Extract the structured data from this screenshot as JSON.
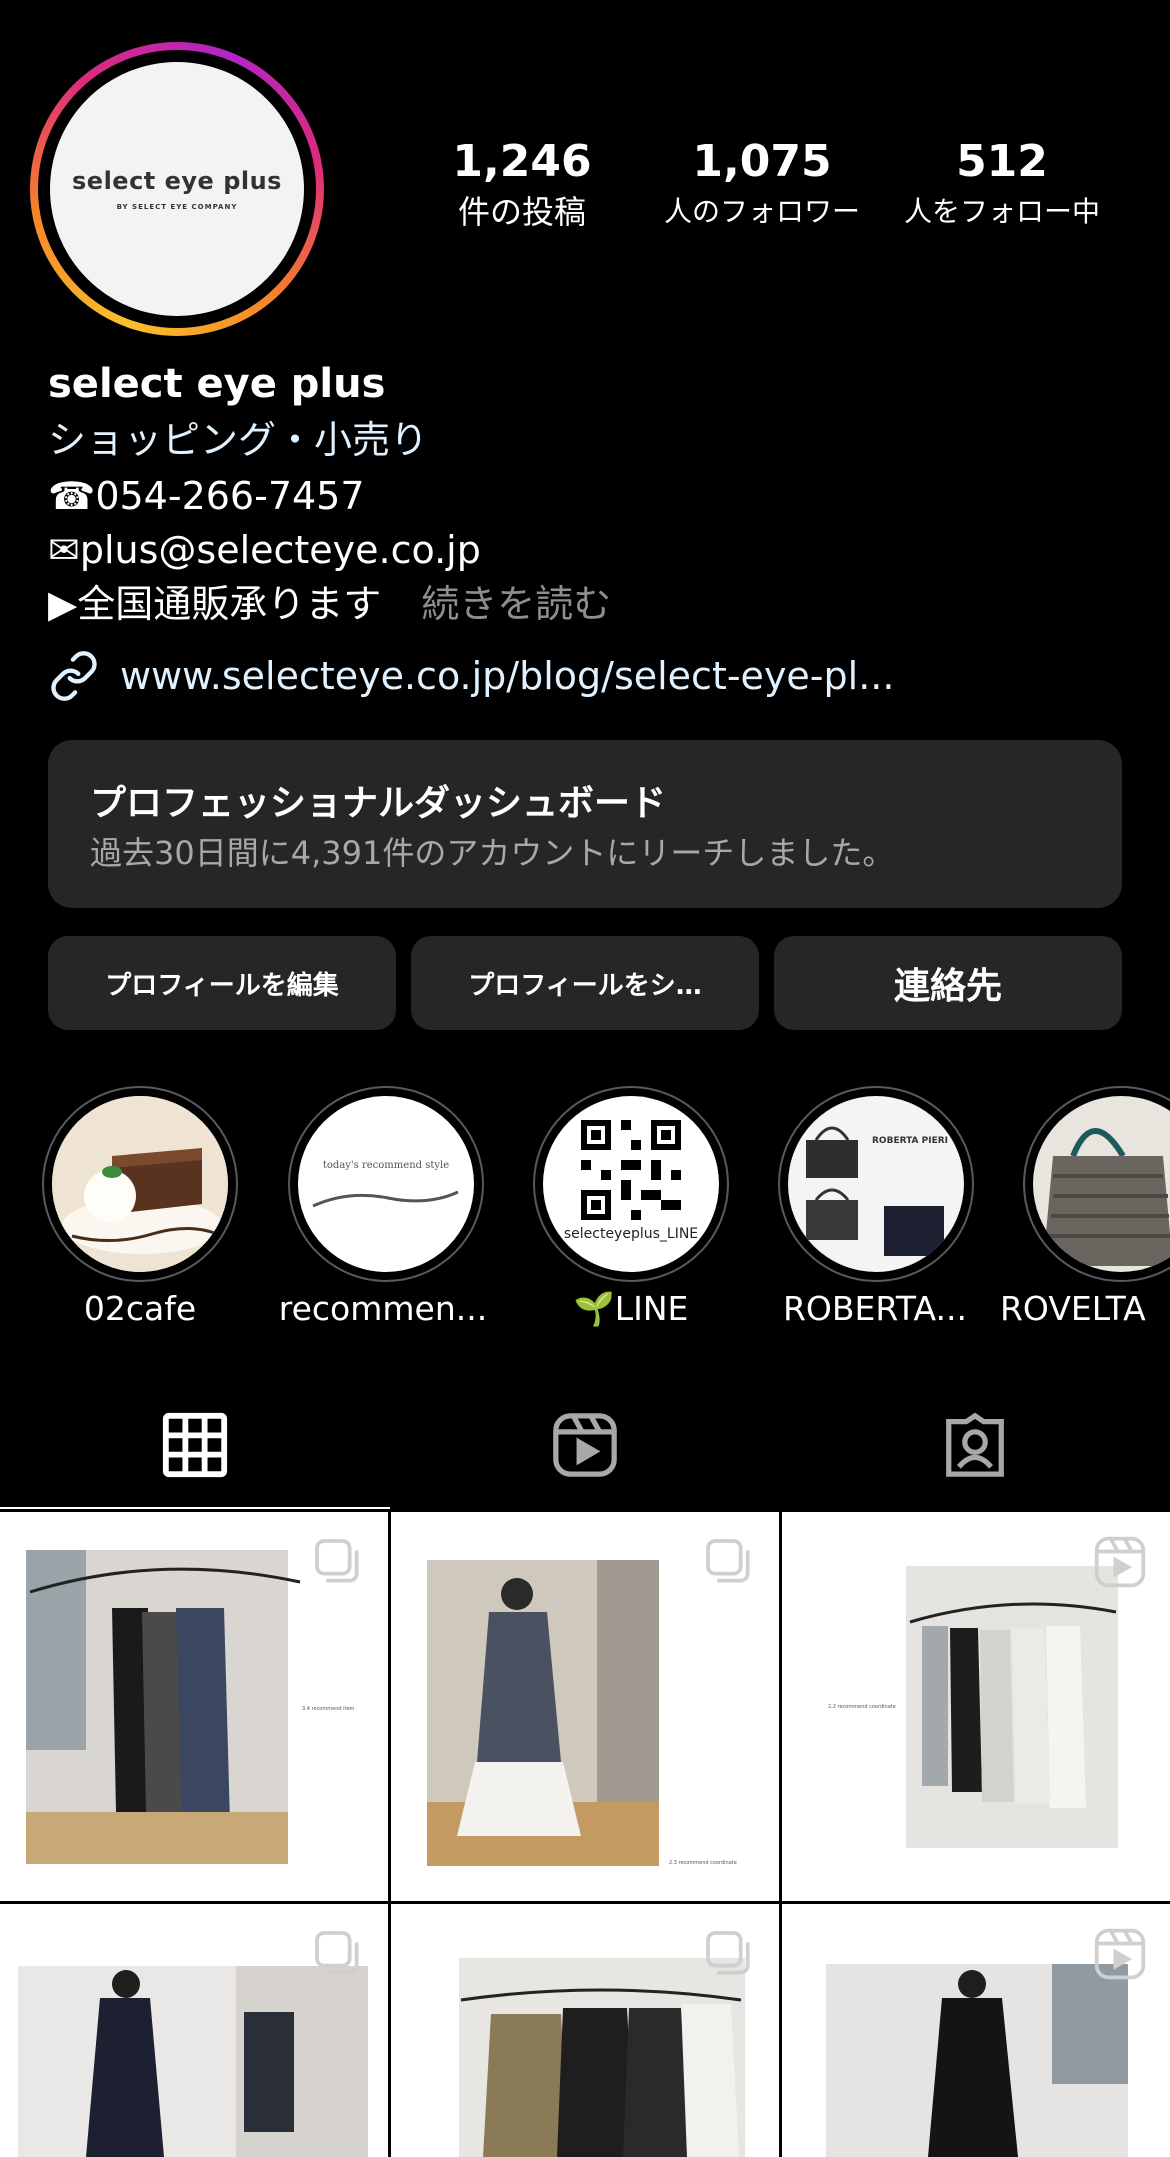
{
  "profile": {
    "avatar_text": "select eye plus",
    "avatar_subtext": "BY SELECT EYE COMPANY",
    "stats": [
      {
        "value": "1,246",
        "label": "件の投稿"
      },
      {
        "value": "1,075",
        "label": "人のフォロワー"
      },
      {
        "value": "512",
        "label": "人をフォロー中"
      }
    ],
    "name": "select eye plus",
    "category": "ショッピング・小売り",
    "phone": "☎054-266-7457",
    "email": "✉plus@selecteye.co.jp",
    "bio_line": "▶全国通販承ります",
    "more_label": "続きを読む",
    "link": "www.selecteye.co.jp/blog/select-eye-pl..."
  },
  "dashboard": {
    "title": "プロフェッショナルダッシュボード",
    "subtitle": "過去30日間に4,391件のアカウントにリーチしました。"
  },
  "buttons": {
    "edit": "プロフィールを編集",
    "share": "プロフィールをシ…",
    "contact": "連絡先"
  },
  "highlights": [
    {
      "label": "02cafe"
    },
    {
      "label": "recommen...",
      "cover_text": "today's recommend style"
    },
    {
      "label": "🌱LINE",
      "cover_text": "selecteyeplus_LINE"
    },
    {
      "label": "ROBERTA...",
      "cover_text": "ROBERTA PIERI"
    },
    {
      "label": "ROVELTA"
    }
  ],
  "tabs": [
    {
      "icon": "grid-icon"
    },
    {
      "icon": "reels-icon"
    },
    {
      "icon": "tagged-icon"
    }
  ],
  "posts": [
    {
      "type": "carousel",
      "caption": "3.4 recommend item"
    },
    {
      "type": "carousel",
      "caption": "2.3 recommend coordinate"
    },
    {
      "type": "reel",
      "caption": "2.2 recommend coordinate"
    },
    {
      "type": "carousel"
    },
    {
      "type": "carousel"
    },
    {
      "type": "reel"
    }
  ],
  "colors": {
    "background": "#000000",
    "surface": "#262626",
    "link": "#e0f1ff",
    "muted": "#8e8e8e"
  }
}
